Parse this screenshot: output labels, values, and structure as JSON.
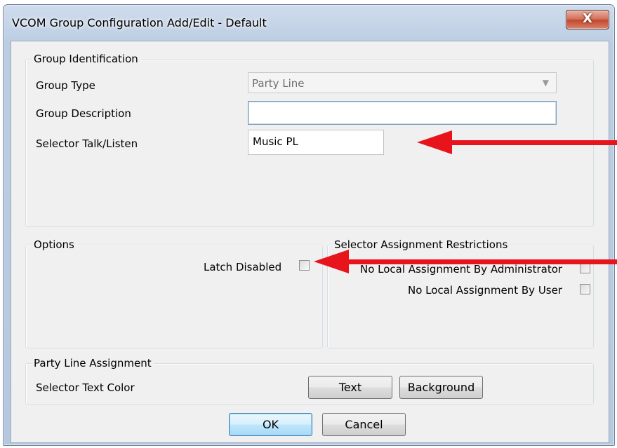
{
  "window": {
    "title": "VCOM Group Configuration Add/Edit - Default",
    "close_label": "X"
  },
  "group_identification": {
    "legend": "Group Identification",
    "group_type_label": "Group Type",
    "group_type_value": "Party Line",
    "group_description_label": "Group Description",
    "group_description_value": "",
    "selector_talk_listen_label": "Selector Talk/Listen",
    "selector_talk_listen_value": "Music PL"
  },
  "options": {
    "legend": "Options",
    "latch_disabled_label": "Latch Disabled",
    "latch_disabled_checked": false
  },
  "restrictions": {
    "legend": "Selector Assignment Restrictions",
    "no_local_admin_label": "No Local Assignment By Administrator",
    "no_local_admin_checked": false,
    "no_local_user_label": "No Local Assignment By User",
    "no_local_user_checked": false
  },
  "party_line": {
    "legend": "Party Line Assignment",
    "selector_text_color_label": "Selector Text Color",
    "text_button": "Text",
    "background_button": "Background"
  },
  "footer": {
    "ok_button": "OK",
    "cancel_button": "Cancel"
  },
  "annotation_color": "#e8141c"
}
